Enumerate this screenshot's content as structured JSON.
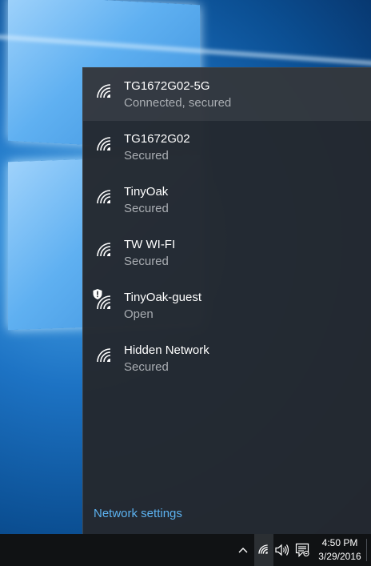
{
  "networks": [
    {
      "name": "TG1672G02-5G",
      "status": "Connected, secured",
      "connected": true,
      "shield": false
    },
    {
      "name": "TG1672G02",
      "status": "Secured",
      "connected": false,
      "shield": false
    },
    {
      "name": "TinyOak",
      "status": "Secured",
      "connected": false,
      "shield": false
    },
    {
      "name": "TW WI-FI",
      "status": "Secured",
      "connected": false,
      "shield": false
    },
    {
      "name": "TinyOak-guest",
      "status": "Open",
      "connected": false,
      "shield": true
    },
    {
      "name": "Hidden Network",
      "status": "Secured",
      "connected": false,
      "shield": false
    }
  ],
  "settings_link": "Network settings",
  "taskbar": {
    "time": "4:50 PM",
    "date": "3/29/2016",
    "icons": [
      "chevron-up-icon",
      "wifi-icon",
      "volume-icon",
      "action-center-icon"
    ]
  },
  "colors": {
    "flyout_bg": "#24282e",
    "link": "#5cb2f0",
    "taskbar_bg": "#101214"
  }
}
